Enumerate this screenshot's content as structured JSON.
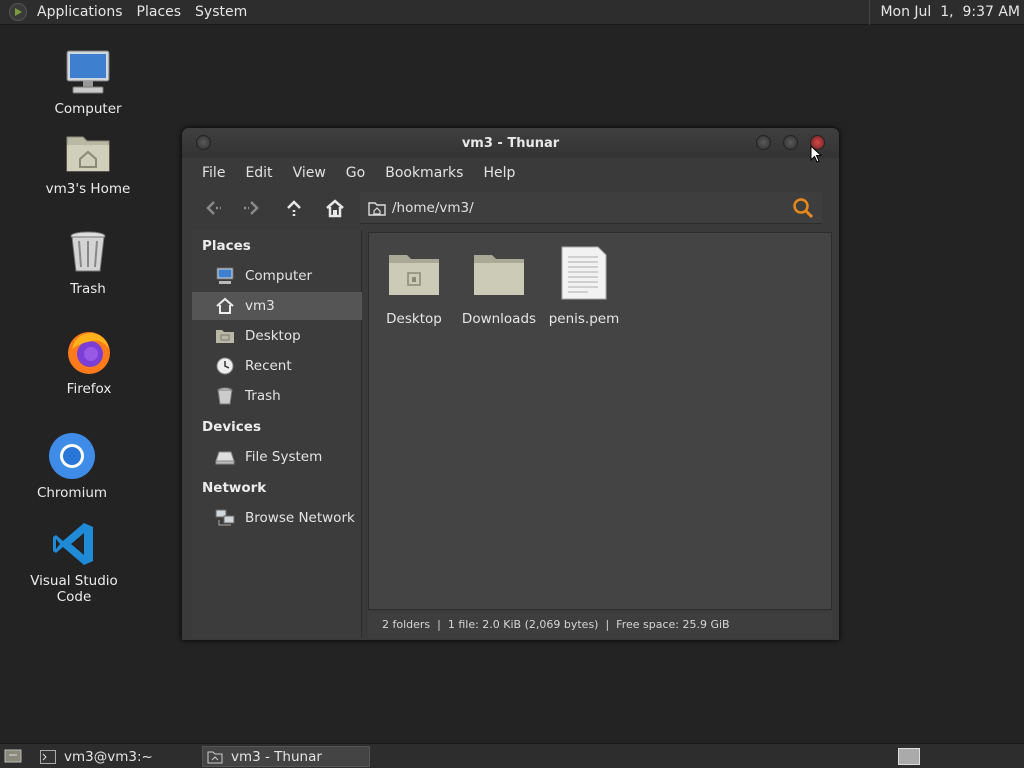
{
  "top_panel": {
    "menus": [
      "Applications",
      "Places",
      "System"
    ],
    "clock": "Mon Jul  1,  9:37 AM"
  },
  "desktop_icons": [
    {
      "label": "Computer",
      "icon": "computer-icon"
    },
    {
      "label": "vm3's Home",
      "icon": "home-folder-icon"
    },
    {
      "label": "Trash",
      "icon": "trash-icon"
    },
    {
      "label": "Firefox",
      "icon": "firefox-icon"
    },
    {
      "label": "Chromium",
      "icon": "chromium-icon"
    },
    {
      "label": "Visual Studio Code",
      "icon": "vscode-icon"
    }
  ],
  "window": {
    "title": "vm3 - Thunar",
    "menu": [
      "File",
      "Edit",
      "View",
      "Go",
      "Bookmarks",
      "Help"
    ],
    "location": "/home/vm3/",
    "sidebar": {
      "places_header": "Places",
      "places": [
        {
          "label": "Computer",
          "icon": "computer-icon"
        },
        {
          "label": "vm3",
          "icon": "home-icon",
          "selected": true
        },
        {
          "label": "Desktop",
          "icon": "desktop-folder-icon"
        },
        {
          "label": "Recent",
          "icon": "clock-icon"
        },
        {
          "label": "Trash",
          "icon": "trash-icon"
        }
      ],
      "devices_header": "Devices",
      "devices": [
        {
          "label": "File System",
          "icon": "drive-icon"
        }
      ],
      "network_header": "Network",
      "network": [
        {
          "label": "Browse Network",
          "icon": "network-icon"
        }
      ]
    },
    "files": [
      {
        "name": "Desktop",
        "icon": "desktop-folder-icon"
      },
      {
        "name": "Downloads",
        "icon": "folder-icon"
      },
      {
        "name": "penis.pem",
        "icon": "text-file-icon"
      }
    ],
    "status": "2 folders  |  1 file: 2.0 KiB (2,069 bytes)  |  Free space: 25.9 GiB"
  },
  "taskbar": {
    "tasks": [
      {
        "label": "vm3@vm3:~",
        "icon": "terminal-icon",
        "active": false
      },
      {
        "label": "vm3 - Thunar",
        "icon": "file-manager-icon",
        "active": true
      }
    ]
  }
}
